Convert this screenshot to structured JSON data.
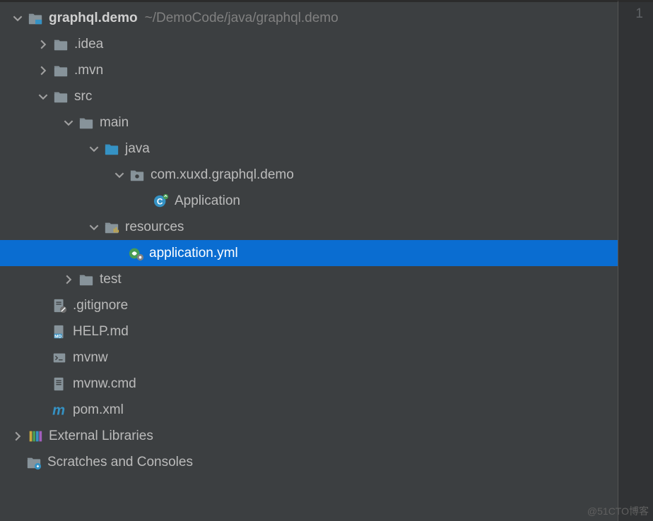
{
  "gutter": {
    "line": "1"
  },
  "watermark": "@51CTO博客",
  "tree": {
    "root": {
      "name": "graphql.demo",
      "path": "~/DemoCode/java/graphql.demo"
    },
    "idea": ".idea",
    "mvn": ".mvn",
    "src": "src",
    "main": "main",
    "java": "java",
    "package": "com.xuxd.graphql.demo",
    "application_class": "Application",
    "resources": "resources",
    "application_yml": "application.yml",
    "test": "test",
    "gitignore": ".gitignore",
    "help_md": "HELP.md",
    "mvnw": "mvnw",
    "mvnw_cmd": "mvnw.cmd",
    "pom_xml": "pom.xml",
    "external_libs": "External Libraries",
    "scratches": "Scratches and Consoles"
  }
}
